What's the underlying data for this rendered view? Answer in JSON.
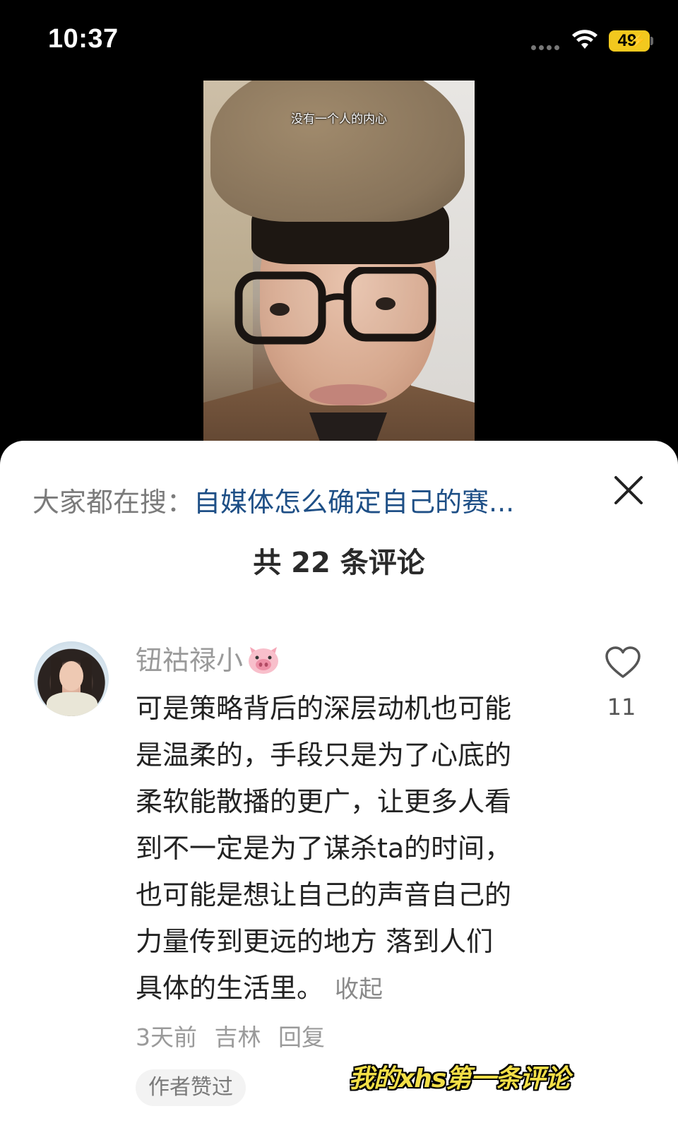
{
  "status_bar": {
    "time": "10:37",
    "battery_level": "49",
    "battery_charging_icon": "bolt-icon",
    "battery_color": "#f2c81e"
  },
  "video": {
    "subtitle": "没有一个人的内心"
  },
  "search_hint": {
    "prefix": "大家都在搜：",
    "query": "自媒体怎么确定自己的赛...",
    "query_color": "#1e4f86"
  },
  "comments_header": {
    "title": "共 22 条评论"
  },
  "comment": {
    "username": "钮祜禄小",
    "username_emoji_icon": "pig-face-icon",
    "like_count": "11",
    "lines": [
      "可是策略背后的深层动机也可能",
      "是温柔的，手段只是为了心底的",
      "柔软能散播的更广，让更多人看",
      "到不一定是为了谋杀ta的时间，",
      "也可能是想让自己的声音自己的",
      "力量传到更远的地方 落到人们",
      "具体的生活里。"
    ],
    "collapse_label": "收起",
    "time": "3天前",
    "location": "吉林",
    "reply_label": "回复",
    "author_liked_badge": "作者赞过"
  },
  "overlay_caption": "我的xhs第一条评论"
}
